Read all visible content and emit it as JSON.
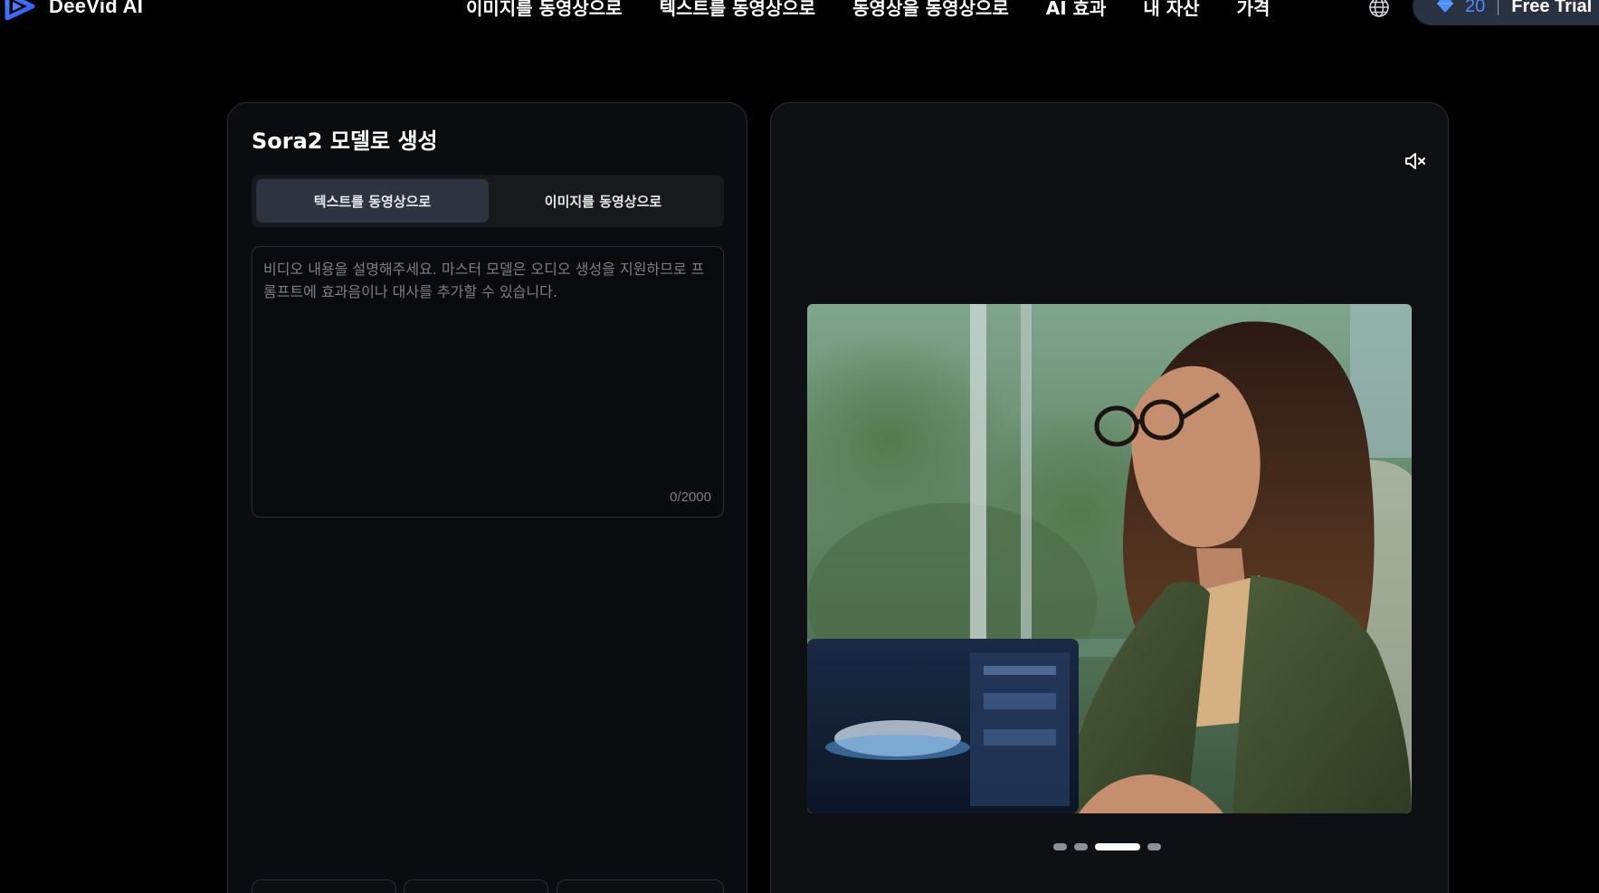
{
  "brand": {
    "name": "DeeVid AI"
  },
  "nav": {
    "items": [
      {
        "label": "이미지를 동영상으로"
      },
      {
        "label": "텍스트를 동영상으로"
      },
      {
        "label": "동영상을 동영상으로"
      },
      {
        "label": "AI 효과"
      },
      {
        "label": "내 자산"
      },
      {
        "label": "가격"
      }
    ],
    "language_icon": "globe-icon"
  },
  "account": {
    "credits": "20",
    "credit_icon": "diamond-icon",
    "trial_label": "Free Trial"
  },
  "generator": {
    "title": "Sora2 모델로 생성",
    "tabs": [
      {
        "label": "텍스트를 동영상으로",
        "active": true
      },
      {
        "label": "이미지를 동영상으로",
        "active": false
      }
    ],
    "prompt": {
      "value": "",
      "placeholder": "비디오 내용을 설명해주세요. 마스터 모델은 오디오 생성을 지원하므로 프롬프트에 효과음이나 대사를 추가할 수 있습니다.",
      "char_count": "0/2000"
    }
  },
  "preview": {
    "mute_icon": "speaker-muted-icon",
    "carousel": {
      "slides": 4,
      "active_index": 2
    }
  },
  "colors": {
    "background": "#000000",
    "panel": "#0b0c0f",
    "active_tab": "#2e3340",
    "credit_accent": "#4d8cff",
    "credits_pill": "#2a3140"
  }
}
